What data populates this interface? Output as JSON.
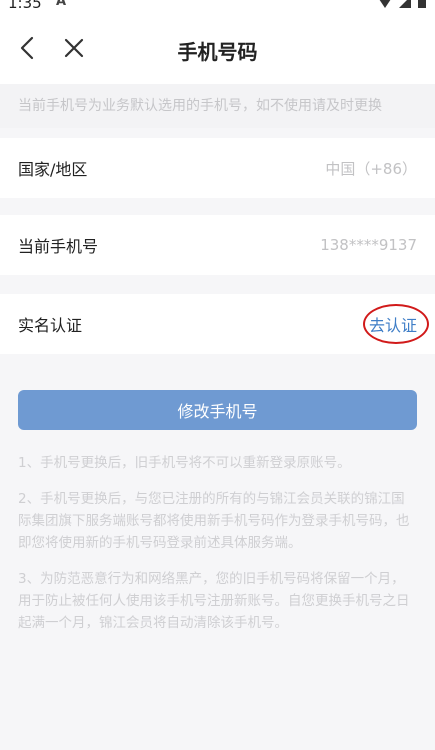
{
  "status_bar": {
    "time": "1:35",
    "indicator": "A"
  },
  "header": {
    "title": "手机号码",
    "back_icon": "chevron-left-icon",
    "close_icon": "close-icon"
  },
  "notice": "当前手机号为业务默认选用的手机号，如不使用请及时更换",
  "rows": [
    {
      "label": "国家/地区",
      "value": "中国（+86）"
    },
    {
      "label": "当前手机号",
      "value": "138****9137"
    },
    {
      "label": "实名认证",
      "action": "去认证"
    }
  ],
  "primary_button": "修改手机号",
  "notes": [
    "1、手机号更换后，旧手机号将不可以重新登录原账号。",
    "2、手机号更换后，与您已注册的所有的与锦江会员关联的锦江国际集团旗下服务端账号都将使用新手机号码作为登录手机号码，也即您将使用新的手机号码登录前述具体服务端。",
    "3、为防范恶意行为和网络黑产，您的旧手机号码将保留一个月，用于防止被任何人使用该手机号注册新账号。自您更换手机号之日起满一个月，锦江会员将自动清除该手机号。"
  ],
  "colors": {
    "link": "#3f7ec7",
    "button": "#6f9ad2",
    "highlight": "#d11a1a"
  }
}
